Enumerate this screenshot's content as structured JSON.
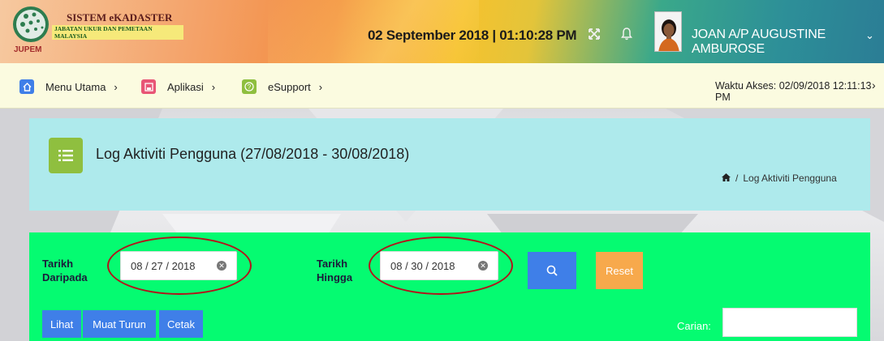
{
  "header": {
    "logo_title": "SISTEM eKADASTER",
    "logo_subtitle": "JABATAN UKUR DAN PEMETAAN MALAYSIA",
    "logo_mark": "JUPEM",
    "datetime": "02 September 2018 | 01:10:28 PM",
    "fullscreen_icon": "expand-arrows-icon",
    "notification_icon": "bell-icon",
    "username": "JOAN A/P AUGUSTINE AMBUROSE",
    "user_menu_chevron": "⌄"
  },
  "nav": {
    "items": [
      {
        "label": "Menu Utama",
        "icon": "home-icon",
        "color": "#3f7fe8",
        "chevron": "›"
      },
      {
        "label": "Aplikasi",
        "icon": "save-icon",
        "color": "#e85575",
        "chevron": "›"
      },
      {
        "label": "eSupport",
        "icon": "help-icon",
        "color": "#8fbf3f",
        "chevron": "›"
      }
    ],
    "access_time": "Waktu Akses: 02/09/2018 12:11:13 PM",
    "access_chevron": "›"
  },
  "title_panel": {
    "title": "Log Aktiviti Pengguna (27/08/2018 - 30/08/2018)",
    "breadcrumb_sep": "/",
    "breadcrumb_current": "Log Aktiviti Pengguna"
  },
  "filter": {
    "from_label_line1": "Tarikh",
    "from_label_line2": "Daripada",
    "from_value": "08 / 27 / 2018",
    "to_label_line1": "Tarikh",
    "to_label_line2": "Hingga",
    "to_value": "08 / 30 / 2018",
    "search_icon": "search-icon",
    "reset_label": "Reset",
    "view_label": "Lihat",
    "download_label": "Muat Turun",
    "print_label": "Cetak",
    "search_label": "Carian:",
    "search_value": ""
  },
  "colors": {
    "title_panel_bg": "#aeeaec",
    "filter_panel_bg": "#05fb71",
    "annotation_oval": "#b3131b",
    "primary_button": "#3f7fe8",
    "reset_button": "#f7a94c",
    "navbar_bg": "#fbfbe0"
  }
}
